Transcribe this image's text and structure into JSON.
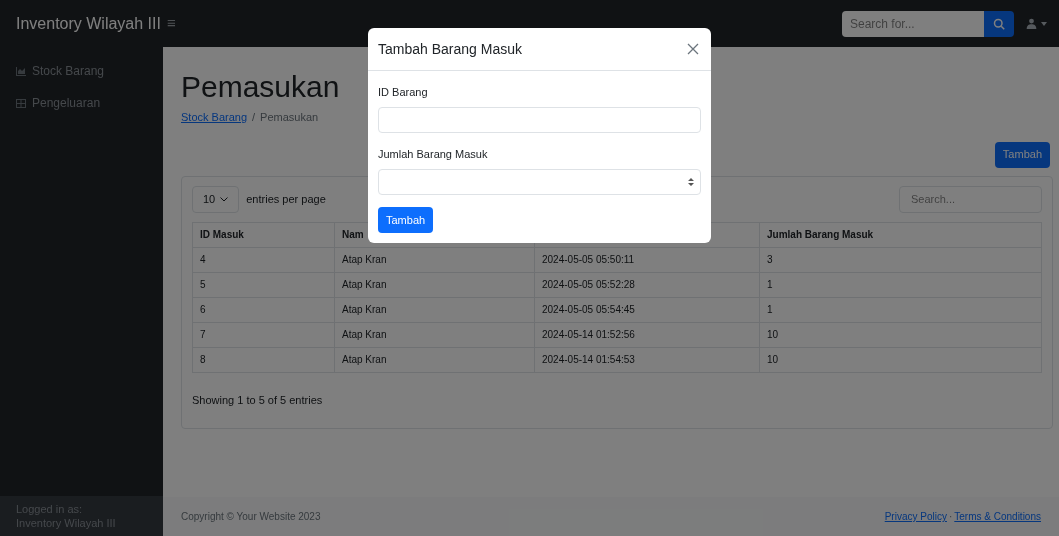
{
  "navbar": {
    "brand": "Inventory Wilayah III",
    "menu_toggle": "≡",
    "search": {
      "placeholder": "Search for..."
    }
  },
  "sidebar": {
    "items": [
      {
        "label": "Stock Barang"
      },
      {
        "label": "Pengeluaran"
      }
    ],
    "footer": {
      "caption": "Logged in as:",
      "user": "Inventory Wilayah III"
    }
  },
  "page": {
    "title": "Pemasukan",
    "breadcrumb": [
      {
        "label": "Stock Barang",
        "link": true
      },
      {
        "label": "Pemasukan",
        "link": false
      }
    ],
    "breadcrumb_separator": "/",
    "add_button": "Tambah"
  },
  "datatable": {
    "per_page": "10",
    "per_page_label": "entries per page",
    "search_placeholder": "Search...",
    "columns": [
      {
        "label": "ID Masuk"
      },
      {
        "label": "Nam"
      },
      {},
      {
        "label": "Jumlah Barang Masuk"
      }
    ],
    "rows": [
      [
        "4",
        "Atap Kran",
        "2024-05-05 05:50:11",
        "3"
      ],
      [
        "5",
        "Atap Kran",
        "2024-05-05 05:52:28",
        "1"
      ],
      [
        "6",
        "Atap Kran",
        "2024-05-05 05:54:45",
        "1"
      ],
      [
        "7",
        "Atap Kran",
        "2024-05-14 01:52:56",
        "10"
      ],
      [
        "8",
        "Atap Kran",
        "2024-05-14 01:54:53",
        "10"
      ]
    ],
    "info": "Showing 1 to 5 of 5 entries"
  },
  "footer": {
    "copyright": "Copyright © Your Website 2023",
    "links": [
      "Privacy Policy",
      "Terms & Conditions"
    ],
    "separator": "·"
  },
  "modal": {
    "title": "Tambah Barang Masuk",
    "fields": [
      {
        "label": "ID Barang",
        "kind": "text"
      },
      {
        "label": "Jumlah Barang Masuk",
        "kind": "number"
      }
    ],
    "submit": "Tambah"
  }
}
